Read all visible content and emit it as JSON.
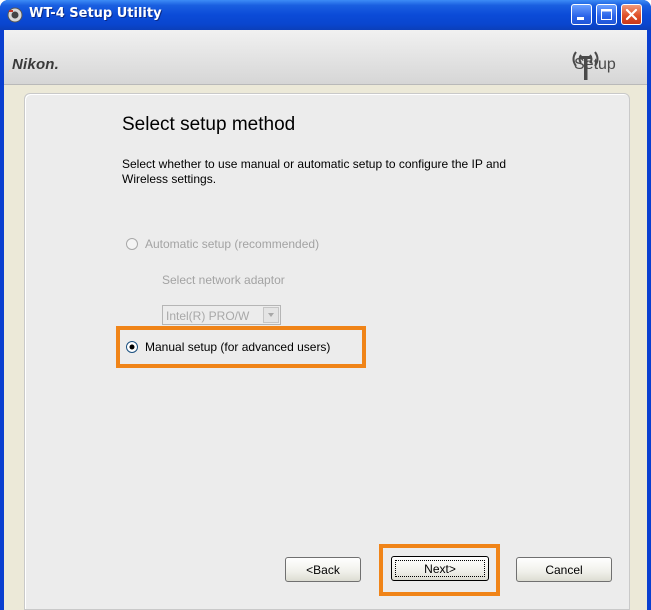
{
  "window": {
    "title": "WT-4 Setup Utility"
  },
  "header": {
    "brand": "Nikon.",
    "logo_text": "Setup"
  },
  "main": {
    "heading": "Select setup method",
    "description": "Select whether to use manual or automatic setup to configure the IP and Wireless settings.",
    "automatic": {
      "label": "Automatic setup (recommended)",
      "selected": false,
      "enabled": false
    },
    "adapter_label": "Select network adaptor",
    "adapter_value": "Intel(R) PRO/W",
    "manual": {
      "label": "Manual setup (for advanced users)",
      "selected": true,
      "enabled": true
    }
  },
  "buttons": {
    "back": "<Back",
    "next": "Next>",
    "cancel": "Cancel"
  },
  "colors": {
    "highlight": "#f08418",
    "titlebar": "#0a46cf"
  },
  "icons": {
    "app": "camera-icon",
    "logo": "wireless-antenna-icon",
    "minimize": "minimize-icon",
    "maximize": "maximize-icon",
    "close": "close-icon",
    "dropdown": "chevron-down-icon"
  }
}
